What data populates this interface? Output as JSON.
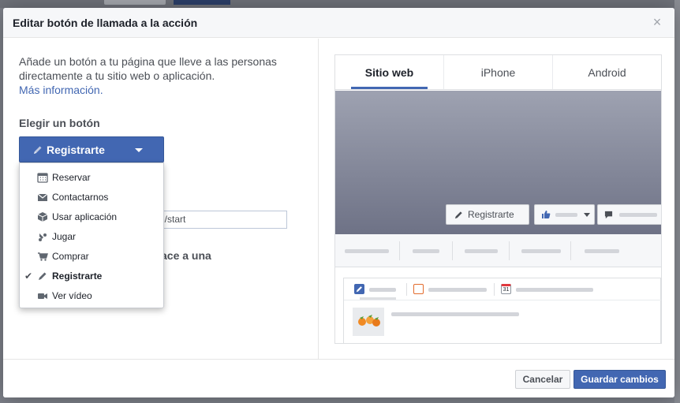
{
  "dialog": {
    "title": "Editar botón de llamada a la acción",
    "close_glyph": "×"
  },
  "left": {
    "intro_text": "Añade un botón a tu página que lleve a las personas directamente a tu sitio web o aplicación.",
    "more_info_link": "Más información.",
    "choose_label": "Elegir un botón",
    "selected_button": "Registrarte",
    "url_value": "d/start",
    "partial_heading": "ace a una"
  },
  "menu": {
    "items": [
      {
        "label": "Reservar",
        "icon": "calendar-icon"
      },
      {
        "label": "Contactarnos",
        "icon": "envelope-icon"
      },
      {
        "label": "Usar aplicación",
        "icon": "cube-icon"
      },
      {
        "label": "Jugar",
        "icon": "gamepad-icon"
      },
      {
        "label": "Comprar",
        "icon": "cart-icon"
      },
      {
        "label": "Registrarte",
        "icon": "pencil-icon",
        "selected": true
      },
      {
        "label": "Ver vídeo",
        "icon": "video-camera-icon"
      }
    ],
    "check_glyph": "✔"
  },
  "preview": {
    "tabs": [
      {
        "label": "Sitio web",
        "active": true
      },
      {
        "label": "iPhone",
        "active": false
      },
      {
        "label": "Android",
        "active": false
      }
    ],
    "cta_label": "Registrarte",
    "calendar_day": "31"
  },
  "footer": {
    "cancel_label": "Cancelar",
    "save_label": "Guardar cambios"
  },
  "colors": {
    "brand_blue": "#4267b2",
    "cover_top": "#9ea2b1",
    "cover_bottom": "#6e7286"
  }
}
